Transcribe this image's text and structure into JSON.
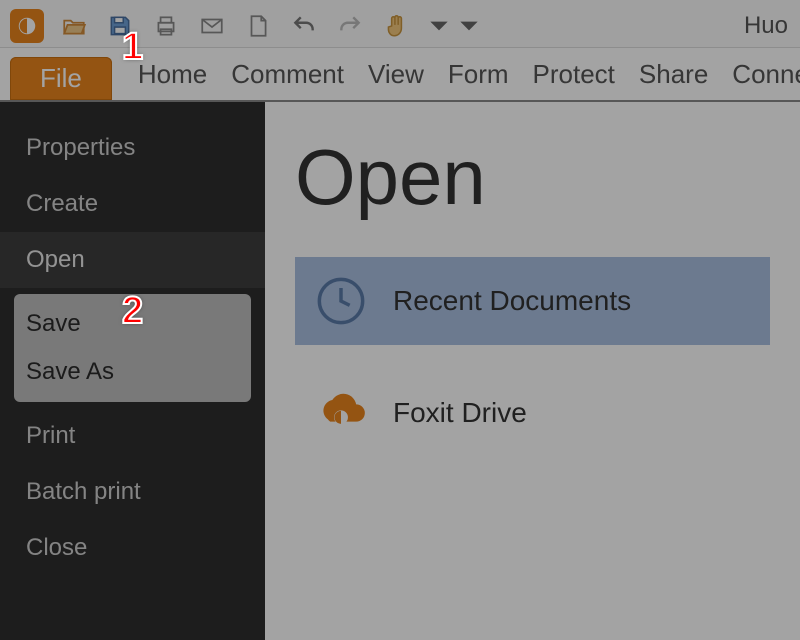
{
  "colors": {
    "accent": "#e8841d",
    "selection": "#a9bfe0"
  },
  "qat": {
    "user_text": "Huo"
  },
  "tabs": {
    "file": "File",
    "items": [
      "Home",
      "Comment",
      "View",
      "Form",
      "Protect",
      "Share",
      "Connect"
    ]
  },
  "sidebar": {
    "items": [
      {
        "label": "Properties"
      },
      {
        "label": "Create"
      },
      {
        "label": "Open"
      },
      {
        "label": "Save"
      },
      {
        "label": "Save As"
      },
      {
        "label": "Print"
      },
      {
        "label": "Batch print"
      },
      {
        "label": "Close"
      }
    ]
  },
  "content": {
    "title": "Open",
    "locations": [
      {
        "label": "Recent Documents",
        "icon": "clock-icon"
      },
      {
        "label": "Foxit Drive",
        "icon": "foxit-drive-icon"
      }
    ]
  },
  "callouts": {
    "c1": "1",
    "c2": "2"
  }
}
